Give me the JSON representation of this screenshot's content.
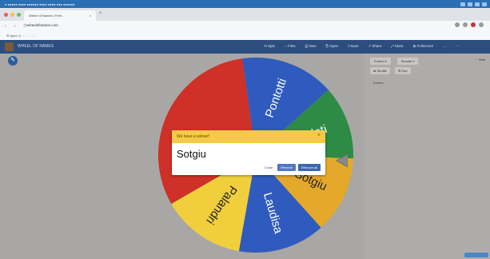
{
  "browser": {
    "tab_title": "Wheel of Names | Free ...",
    "tab_close": "×",
    "new_tab": "+",
    "url": "wheelofnames.com",
    "bookmarks": "☰ Apps   ◷ …  …  ·  …"
  },
  "app": {
    "brand": "WHEEL OF NAMES",
    "menu": [
      "⟲ Spin",
      "◌ Files",
      "⎙ New",
      "⎘ Open",
      "⟟ Save",
      "↗ Share",
      "⤢ More",
      "⊞ Fullscreen",
      "…",
      "⋯"
    ]
  },
  "wheel": {
    "segments": [
      {
        "label": "Pontotti",
        "color": "#2f5bbf"
      },
      {
        "label": "Sidoti",
        "color": "#2e8b46"
      },
      {
        "label": "Sotgiu",
        "color": "#e4a82a"
      },
      {
        "label": "Laudisa",
        "color": "#2f5bbf"
      },
      {
        "label": "Palandri",
        "color": "#f1cf3c"
      },
      {
        "label": "",
        "color": "#cf3027"
      }
    ]
  },
  "side_panel": {
    "tab_entries": "Entries 6",
    "tab_results": "Results 0",
    "btn_shuffle": "⇄ Shuffle",
    "btn_sort": "⇅ Sort",
    "label": "Entries",
    "results_hint": "⋯ Hide"
  },
  "dialog": {
    "title": "We have a winner!",
    "close_icon": "×",
    "winner": "Sotgiu",
    "close_label": "Close",
    "remove_label": "Remove",
    "remove_all_label": "Remove all"
  }
}
